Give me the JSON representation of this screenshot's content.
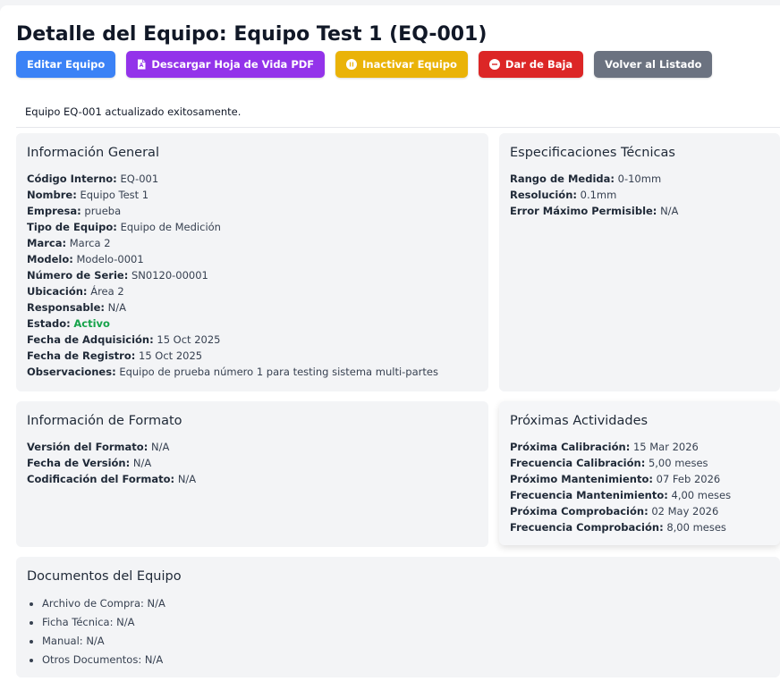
{
  "header": {
    "title": "Detalle del Equipo: Equipo Test 1 (EQ-001)"
  },
  "actions": {
    "edit": "Editar Equipo",
    "download_pdf": "Descargar Hoja de Vida PDF",
    "deactivate": "Inactivar Equipo",
    "decommission": "Dar de Baja",
    "back": "Volver al Listado"
  },
  "flash": {
    "message": "Equipo EQ-001 actualizado exitosamente."
  },
  "general": {
    "title": "Información General",
    "fields": [
      {
        "label": "Código Interno:",
        "value": "EQ-001"
      },
      {
        "label": "Nombre:",
        "value": "Equipo Test 1"
      },
      {
        "label": "Empresa:",
        "value": "prueba"
      },
      {
        "label": "Tipo de Equipo:",
        "value": "Equipo de Medición"
      },
      {
        "label": "Marca:",
        "value": "Marca 2"
      },
      {
        "label": "Modelo:",
        "value": "Modelo-0001"
      },
      {
        "label": "Número de Serie:",
        "value": "SN0120-00001"
      },
      {
        "label": "Ubicación:",
        "value": "Área 2"
      },
      {
        "label": "Responsable:",
        "value": "N/A"
      },
      {
        "label": "Estado:",
        "value": "Activo"
      },
      {
        "label": "Fecha de Adquisición:",
        "value": "15 Oct 2025"
      },
      {
        "label": "Fecha de Registro:",
        "value": "15 Oct 2025"
      },
      {
        "label": "Observaciones:",
        "value": "Equipo de prueba número 1 para testing sistema multi-partes"
      }
    ]
  },
  "specs": {
    "title": "Especificaciones Técnicas",
    "fields": [
      {
        "label": "Rango de Medida:",
        "value": "0-10mm"
      },
      {
        "label": "Resolución:",
        "value": "0.1mm"
      },
      {
        "label": "Error Máximo Permisible:",
        "value": "N/A"
      }
    ]
  },
  "format": {
    "title": "Información de Formato",
    "fields": [
      {
        "label": "Versión del Formato:",
        "value": "N/A"
      },
      {
        "label": "Fecha de Versión:",
        "value": "N/A"
      },
      {
        "label": "Codificación del Formato:",
        "value": "N/A"
      }
    ]
  },
  "upcoming": {
    "title": "Próximas Actividades",
    "fields": [
      {
        "label": "Próxima Calibración:",
        "value": "15 Mar 2026"
      },
      {
        "label": "Frecuencia Calibración:",
        "value": "5,00 meses"
      },
      {
        "label": "Próximo Mantenimiento:",
        "value": "07 Feb 2026"
      },
      {
        "label": "Frecuencia Mantenimiento:",
        "value": "4,00 meses"
      },
      {
        "label": "Próxima Comprobación:",
        "value": "02 May 2026"
      },
      {
        "label": "Frecuencia Comprobación:",
        "value": "8,00 meses"
      }
    ]
  },
  "documents": {
    "title": "Documentos del Equipo",
    "items": [
      "Archivo de Compra: N/A",
      "Ficha Técnica: N/A",
      "Manual: N/A",
      "Otros Documentos: N/A"
    ]
  },
  "icons": {
    "download_pdf": "pdf-file-icon",
    "deactivate": "pause-circle-icon",
    "decommission": "minus-circle-icon"
  },
  "colors": {
    "edit": "#3b82f6",
    "download_pdf": "#9333ea",
    "deactivate": "#eab308",
    "decommission": "#dc2626",
    "back": "#6b7280",
    "status_active": "#16a34a"
  }
}
